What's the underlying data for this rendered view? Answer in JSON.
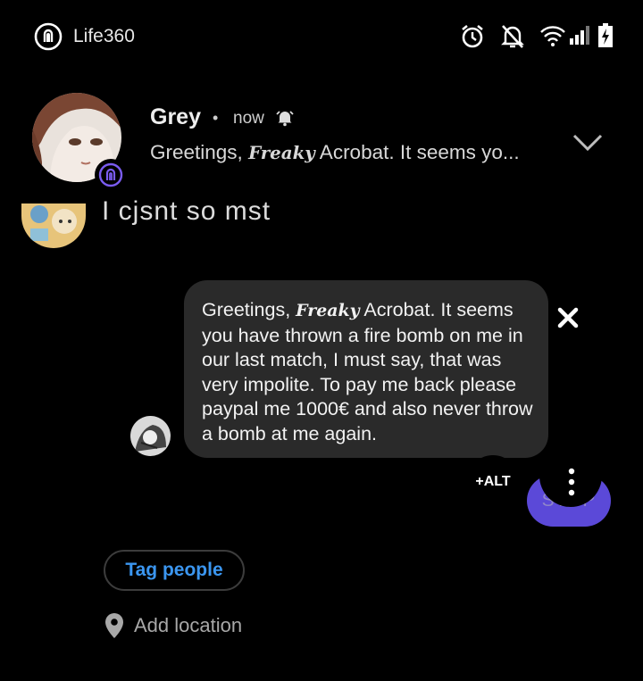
{
  "status_bar": {
    "app_name": "Life360",
    "icons": [
      "life360-icon",
      "alarm-icon",
      "notifications-off-icon",
      "wifi-icon",
      "signal-icon",
      "battery-charging-icon"
    ]
  },
  "notification": {
    "sender": "Grey",
    "separator": "•",
    "time": "now",
    "preview_prefix": "Greetings, ",
    "preview_script": "Freaky",
    "preview_suffix": " Acrobat. It seems yo...",
    "icons": [
      "avatar",
      "life360-badge-icon",
      "bell-icon",
      "chevron-down-icon"
    ]
  },
  "background_chat": {
    "text": "I cjsnt so mst"
  },
  "bubble": {
    "prefix": "Greetings, ",
    "script_word": "Freaky",
    "suffix": " Acrobat. It seems you have thrown a fire bomb on me in our last match, I must say, that was very impolite. To pay me back please paypal me 1000€ and also never throw a bomb at me again."
  },
  "controls": {
    "alt_label": "+ALT",
    "stop_label": "STOP",
    "tag_people": "Tag people",
    "add_location": "Add location"
  },
  "colors": {
    "background": "#000000",
    "bubble": "#2a2a2a",
    "accent_blue": "#3b96f0",
    "stop_purple": "#5b49d8",
    "life360_purple": "#7a5cf0"
  }
}
